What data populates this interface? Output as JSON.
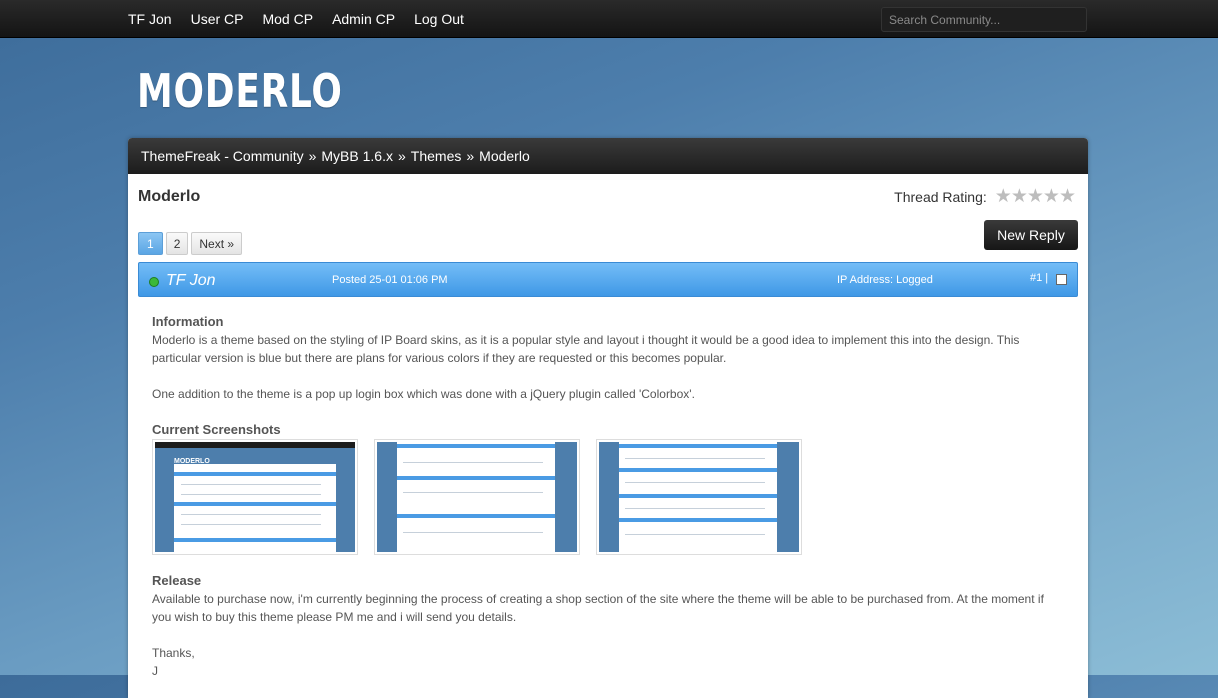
{
  "topnav": {
    "items": [
      "TF Jon",
      "User CP",
      "Mod CP",
      "Admin CP",
      "Log Out"
    ],
    "search_placeholder": "Search Community..."
  },
  "logo": "MODERLO",
  "breadcrumb": [
    "ThemeFreak - Community",
    "MyBB 1.6.x",
    "Themes",
    "Moderlo"
  ],
  "breadcrumb_sep": "»",
  "thread": {
    "title": "Moderlo",
    "rating_label": "Thread Rating:",
    "rating_stars": 5,
    "rating_value": 0
  },
  "pagination": {
    "pages": [
      "1",
      "2"
    ],
    "active": "1",
    "next": "Next »"
  },
  "new_reply": "New Reply",
  "post": {
    "author": "TF Jon",
    "status_color": "#3bb83b",
    "posted": "Posted 25-01 01:06 PM",
    "ip": "IP Address: Logged",
    "number": "#1 |",
    "info_heading": "Information",
    "info_text": "Moderlo is a theme based on the styling of IP Board skins, as it is a popular style and layout i thought it would be a good idea to implement this into the design. This particular version is blue but there are plans for various colors if they are requested or this becomes popular.",
    "addition_text": "One addition to the theme is a pop up login box which was done with a jQuery plugin called 'Colorbox'.",
    "screens_heading": "Current Screenshots",
    "release_heading": "Release",
    "release_text": "Available to purchase now, i'm currently beginning the process of creating a shop section of the site where the theme will be able to be purchased from. At the moment if you wish to buy this theme please PM me and i will send you details.",
    "thanks": "Thanks,",
    "signoff": "J"
  },
  "colors": {
    "accent": "#4a9be4",
    "topbar": "#1c1c1c",
    "background": "#4d7eac"
  }
}
